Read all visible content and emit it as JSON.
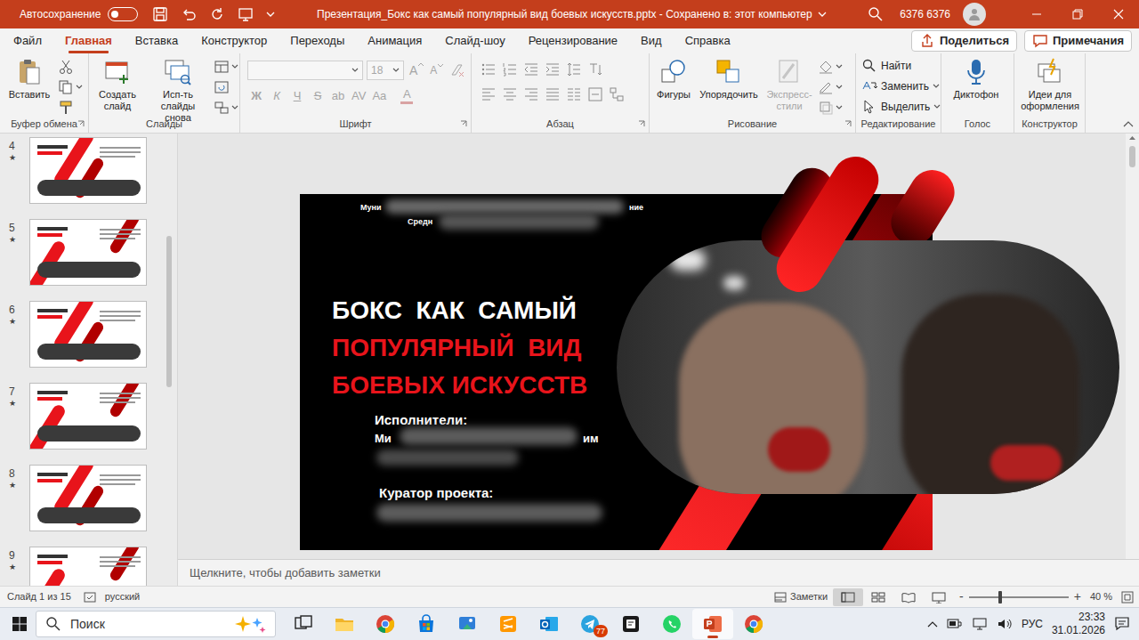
{
  "window": {
    "autosave": {
      "label": "Автосохранение",
      "on": false
    },
    "title": "Презентация_Бокс как самый популярный вид боевых искусств.pptx  -  Сохранено в: этот компьютер",
    "user": "6376 6376"
  },
  "menu_tabs": [
    {
      "label": "Файл",
      "selected": false
    },
    {
      "label": "Главная",
      "selected": true
    },
    {
      "label": "Вставка",
      "selected": false
    },
    {
      "label": "Конструктор",
      "selected": false
    },
    {
      "label": "Переходы",
      "selected": false
    },
    {
      "label": "Анимация",
      "selected": false
    },
    {
      "label": "Слайд-шоу",
      "selected": false
    },
    {
      "label": "Рецензирование",
      "selected": false
    },
    {
      "label": "Вид",
      "selected": false
    },
    {
      "label": "Справка",
      "selected": false
    }
  ],
  "share": "Поделиться",
  "comments": "Примечания",
  "ribbon": {
    "clipboard": {
      "label": "Буфер обмена",
      "paste": "Вставить"
    },
    "slides": {
      "label": "Слайды",
      "new_slide": "Создать слайд",
      "reuse": "Исп-ть слайды снова"
    },
    "font": {
      "label": "Шрифт",
      "size": "18",
      "disabled": true,
      "size_buttons": [
        "A",
        "A"
      ],
      "buttons": [
        {
          "label": "Ж",
          "kind": "bold"
        },
        {
          "label": "К",
          "kind": "italic"
        },
        {
          "label": "Ч",
          "kind": "underline"
        },
        {
          "label": "S",
          "kind": "strike"
        },
        {
          "label": "ab",
          "kind": "plain"
        },
        {
          "label": "AV",
          "kind": "plain"
        },
        {
          "label": "Aa",
          "kind": "plain"
        },
        {
          "label": "A",
          "kind": "color"
        }
      ]
    },
    "paragraph": {
      "label": "Абзац"
    },
    "drawing": {
      "label": "Рисование",
      "shapes": "Фигуры",
      "arrange": "Упорядочить",
      "styles": {
        "label": "Экспресс-стили",
        "disabled": true
      }
    },
    "editing": {
      "label": "Редактирование",
      "items": [
        {
          "label": "Найти",
          "kind": "find"
        },
        {
          "label": "Заменить",
          "kind": "replace"
        },
        {
          "label": "Выделить",
          "kind": "select"
        }
      ]
    },
    "voice": {
      "label": "Голос",
      "dictate": "Диктофон"
    },
    "designer": {
      "label": "Конструктор",
      "ideas": "Идеи для оформления"
    }
  },
  "slides_panel": {
    "items": [
      {
        "number": "4",
        "star": "★"
      },
      {
        "number": "5",
        "star": "★"
      },
      {
        "number": "6",
        "star": "★"
      },
      {
        "number": "7",
        "star": "★"
      },
      {
        "number": "8",
        "star": "★"
      },
      {
        "number": "9",
        "star": "★"
      }
    ]
  },
  "slide": {
    "header_fragments": [
      "Муни",
      "ние",
      "Средн"
    ],
    "title_lines": [
      {
        "text": "БОКС  КАК  САМЫЙ",
        "color": "#ffffff"
      },
      {
        "text": "ПОПУЛЯРНЫЙ  ВИД",
        "color": "#e8141b"
      },
      {
        "text": "БОЕВЫХ ИСКУССТВ",
        "color": "#e8141b"
      }
    ],
    "performers_label": "Исполнители:",
    "performer_fragments": [
      "Ми",
      "им"
    ],
    "curator_label": "Куратор проекта:"
  },
  "notes": "Щелкните, чтобы добавить заметки",
  "status_bar": {
    "slide": "Слайд 1 из 15",
    "language": "русский",
    "notes": "Заметки",
    "views": [
      {
        "kind": "normal",
        "selected": true
      },
      {
        "kind": "sorter",
        "selected": false
      },
      {
        "kind": "reading",
        "selected": false
      },
      {
        "kind": "slideshow",
        "selected": false
      }
    ],
    "zoom_out": "-",
    "zoom_in": "+",
    "zoom": {
      "level": 0.3
    },
    "zoom_text": "40 %"
  },
  "taskbar": {
    "search": "Поиск",
    "apps": [
      {
        "kind": "taskview",
        "active": false
      },
      {
        "kind": "explorer",
        "active": false
      },
      {
        "kind": "chrome",
        "active": false
      },
      {
        "kind": "store",
        "active": false
      },
      {
        "kind": "tool",
        "active": false
      },
      {
        "kind": "sublime",
        "active": false
      },
      {
        "kind": "outlook",
        "active": false
      },
      {
        "kind": "telegram",
        "active": false,
        "badge": "77"
      },
      {
        "kind": "notes",
        "active": false
      },
      {
        "kind": "whatsapp",
        "active": false
      },
      {
        "kind": "powerpoint",
        "active": true
      },
      {
        "kind": "chrome",
        "active": false
      }
    ],
    "language": "РУС",
    "time": "23:33",
    "date": "31.01.2026"
  }
}
